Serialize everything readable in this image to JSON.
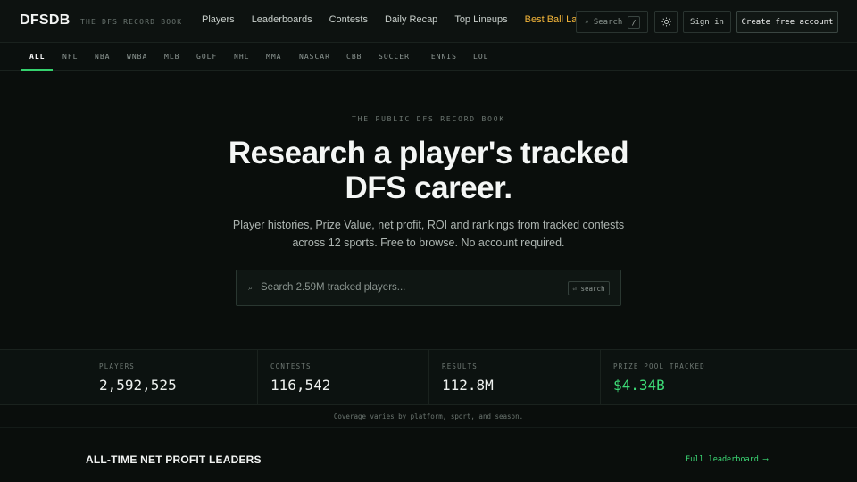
{
  "header": {
    "logo": "DFSDB",
    "tagline": "THE DFS RECORD BOOK",
    "nav": [
      "Players",
      "Leaderboards",
      "Contests",
      "Daily Recap",
      "Top Lineups",
      "Best Ball Lab"
    ],
    "search_label": "Search",
    "search_shortcut": "/",
    "sign_in": "Sign in",
    "create_account": "Create free account"
  },
  "sports": {
    "tabs": [
      "ALL",
      "NFL",
      "NBA",
      "WNBA",
      "MLB",
      "GOLF",
      "NHL",
      "MMA",
      "NASCAR",
      "CBB",
      "SOCCER",
      "TENNIS",
      "LOL"
    ],
    "active": "ALL"
  },
  "hero": {
    "eyebrow": "THE PUBLIC DFS RECORD BOOK",
    "title_line1": "Research a player's tracked",
    "title_line2": "DFS career.",
    "subtitle_line1": "Player histories, Prize Value, net profit, ROI and rankings from tracked contests",
    "subtitle_line2": "across 12 sports. Free to browse. No account required.",
    "search_placeholder": "Search 2.59M tracked players...",
    "search_hint": "⏎ search"
  },
  "stats": [
    {
      "label": "PLAYERS",
      "value": "2,592,525"
    },
    {
      "label": "CONTESTS",
      "value": "116,542"
    },
    {
      "label": "RESULTS",
      "value": "112.8M"
    },
    {
      "label": "PRIZE POOL TRACKED",
      "value": "$4.34B"
    }
  ],
  "coverage_note": "Coverage varies by platform, sport, and season.",
  "leaders": {
    "title": "ALL-TIME NET PROFIT LEADERS",
    "link": "Full leaderboard ⟶"
  },
  "colors": {
    "accent_green": "#3ddc77",
    "accent_orange": "#f5b63a",
    "background": "#0a0e0c"
  }
}
